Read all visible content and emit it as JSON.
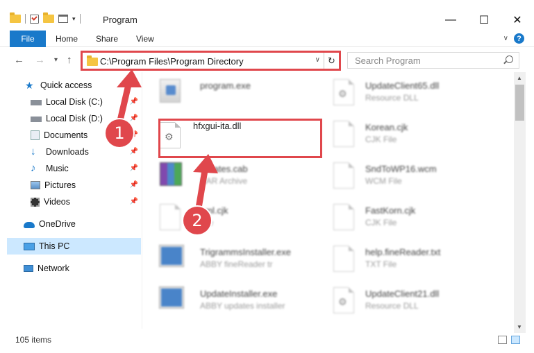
{
  "window": {
    "title": "Program",
    "minimize_glyph": "—",
    "maximize_glyph": "☐",
    "close_glyph": "✕"
  },
  "ribbon": {
    "tabs": [
      "File",
      "Home",
      "Share",
      "View"
    ],
    "help": "?"
  },
  "nav": {
    "back": "←",
    "forward": "→",
    "recent": "▾",
    "up": "↑",
    "address": "C:\\Program Files\\Program Directory",
    "search_placeholder": "Search Program"
  },
  "sidebar": {
    "items": [
      {
        "label": "Quick access",
        "icon": "star-icon"
      },
      {
        "label": "Local Disk (C:)",
        "icon": "drive-icon",
        "pinned": true
      },
      {
        "label": "Local Disk (D:)",
        "icon": "drive-icon",
        "pinned": true
      },
      {
        "label": "Documents",
        "icon": "documents-icon",
        "pinned": true
      },
      {
        "label": "Downloads",
        "icon": "download-icon",
        "pinned": true
      },
      {
        "label": "Music",
        "icon": "music-icon",
        "pinned": true
      },
      {
        "label": "Pictures",
        "icon": "pictures-icon",
        "pinned": true
      },
      {
        "label": "Videos",
        "icon": "videos-icon",
        "pinned": true
      },
      {
        "label": "OneDrive",
        "icon": "cloud-icon"
      },
      {
        "label": "This PC",
        "icon": "computer-icon",
        "selected": true
      },
      {
        "label": "Network",
        "icon": "network-icon"
      }
    ]
  },
  "files": {
    "left": [
      {
        "name": "program.exe",
        "type": ""
      },
      {
        "name": "hfxgui-ita.dll",
        "type": ""
      },
      {
        "name": "tificates.cab",
        "type": "RAR Archive"
      },
      {
        "name": "hml.cjk",
        "type": "File"
      },
      {
        "name": "TrigrammsInstaller.exe",
        "type": "ABBY fineReader tr"
      },
      {
        "name": "UpdateInstaller.exe",
        "type": "ABBY updates installer"
      }
    ],
    "right": [
      {
        "name": "UpdateClient65.dll",
        "type": "Resource DLL"
      },
      {
        "name": "Korean.cjk",
        "type": "CJK File"
      },
      {
        "name": "SndToWP16.wcm",
        "type": "WCM File"
      },
      {
        "name": "FastKorn.cjk",
        "type": "CJK File"
      },
      {
        "name": "help.fineReader.txt",
        "type": "TXT File"
      },
      {
        "name": "UpdateClient21.dll",
        "type": "Resource DLL"
      }
    ]
  },
  "status": {
    "items_count": "105 items"
  },
  "annotations": {
    "step1": "1",
    "step2": "2"
  },
  "colors": {
    "accent": "#1979ca",
    "highlight": "#e0474c",
    "selected_bg": "#cce8ff"
  }
}
